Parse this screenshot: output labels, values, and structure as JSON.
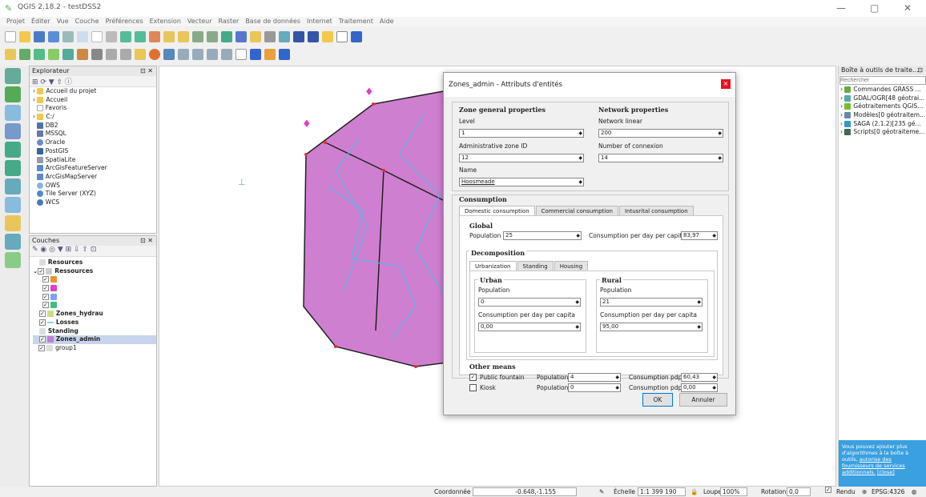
{
  "window": {
    "title": "QGIS 2.18.2 - testDSS2",
    "minimize": "—",
    "maximize": "▢",
    "close": "✕"
  },
  "menu": [
    "Projet",
    "Éditer",
    "Vue",
    "Couche",
    "Préférences",
    "Extension",
    "Vecteur",
    "Raster",
    "Base de données",
    "Internet",
    "Traitement",
    "Aide"
  ],
  "explorer": {
    "title": "Explorateur",
    "items": [
      "Accueil du projet",
      "Accueil",
      "Favoris",
      "C:/",
      "DB2",
      "MSSQL",
      "Oracle",
      "PostGIS",
      "SpatiaLite",
      "ArcGisFeatureServer",
      "ArcGisMapServer",
      "OWS",
      "Tile Server (XYZ)",
      "WCS"
    ]
  },
  "layers": {
    "title": "Couches",
    "items": [
      "Resources",
      "Ressources",
      "Zones_hydrau",
      "Losses",
      "Standing",
      "Zones_admin",
      "group1"
    ]
  },
  "dialog": {
    "title": "Zones_admin - Attributs d'entités",
    "close": "×",
    "zone_general": "Zone general properties",
    "network_properties": "Network properties",
    "level_label": "Level",
    "level_value": "1",
    "network_linear_label": "Network linear",
    "network_linear_value": "200",
    "admin_zone_label": "Administrative zone ID",
    "admin_zone_value": "12",
    "connexion_label": "Number of connexion",
    "connexion_value": "14",
    "name_label": "Name",
    "name_value": "Hoosmeade",
    "consumption": "Consumption",
    "tabs": [
      "Domestic consumption",
      "Commercial consumption",
      "Intusrital consumption"
    ],
    "global": "Global",
    "population_label": "Population",
    "population_value": "25",
    "cpdpc_label": "Consumption per day per capita",
    "cpdpc_value": "83,97",
    "decomposition": "Decomposition",
    "subtabs": [
      "Urbanization",
      "Standing",
      "Housing"
    ],
    "urban": "Urban",
    "rural": "Rural",
    "urban_pop_label": "Population",
    "urban_pop_value": "0",
    "rural_pop_label": "Population",
    "rural_pop_value": "21",
    "urban_cons_label": "Consumption per day per capita",
    "urban_cons_value": "0,00",
    "rural_cons_label": "Consumption per day per capita",
    "rural_cons_value": "95,00",
    "other_means": "Other means",
    "public_fountain": "Public fountain",
    "kiosk": "Kiosk",
    "pf_pop_label": "Population",
    "pf_pop_value": "4",
    "k_pop_label": "Population",
    "k_pop_value": "0",
    "pf_cons_label": "Consumption pdpc",
    "pf_cons_value": "60,43",
    "k_cons_label": "Consumption pdpc",
    "k_cons_value": "0,00",
    "ok": "OK",
    "cancel": "Annuler"
  },
  "toolbox": {
    "title": "Boîte à outils de traite...",
    "search_placeholder": "Rechercher",
    "items": [
      "Commandes GRASS ...",
      "GDAL/OGR[48 géotrai...",
      "Géotraitements QGIS...",
      "Modèles[0 géotraitem...",
      "SAGA (2.1.2)[235 gé...",
      "Scripts[0 géotraiteme..."
    ],
    "advert_text": "Vous pouvez ajouter plus d'algorithmes à la boîte à outils,",
    "advert_link": "autorise des fournisseurs de services additionnels.",
    "advert_close": "[close]"
  },
  "status": {
    "coord_label": "Coordonnée",
    "coord_value": "-0.648,-1.155",
    "scale_label": "Échelle",
    "scale_value": "1:1 399 190",
    "magnifier_label": "Loupe",
    "magnifier_value": "100%",
    "rotation_label": "Rotation",
    "rotation_value": "0,0",
    "render_label": "Rendu",
    "crs": "EPSG:4326"
  }
}
